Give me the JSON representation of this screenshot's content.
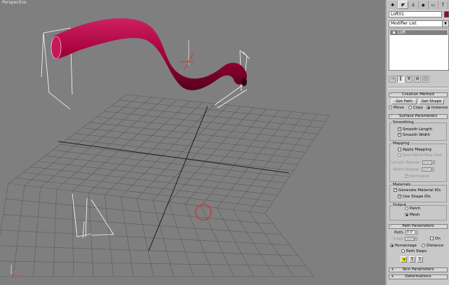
{
  "viewport": {
    "label": "Perspective"
  },
  "command_panel": {
    "tabs": [
      {
        "name": "create",
        "icon": "create-icon",
        "glyph": "✱"
      },
      {
        "name": "modify",
        "icon": "modify-icon",
        "glyph": "◤"
      },
      {
        "name": "hierarchy",
        "icon": "hierarchy-icon",
        "glyph": "♙"
      },
      {
        "name": "motion",
        "icon": "motion-icon",
        "glyph": "◉"
      },
      {
        "name": "display",
        "icon": "display-icon",
        "glyph": "▭"
      },
      {
        "name": "utilities",
        "icon": "utilities-icon",
        "glyph": "T"
      }
    ],
    "object_name": "Loft01",
    "object_color": "#990033",
    "modifier_list": "Modifier List",
    "stack_items": [
      "Loft"
    ],
    "stack_tools": [
      "⊣",
      "‖",
      "∀",
      "⊘",
      "▢"
    ]
  },
  "rollouts": {
    "creation_method": {
      "title": "Creation Method",
      "get_path": "Get Path",
      "get_shape": "Get Shape",
      "move": "Move",
      "copy": "Copy",
      "instance": "Instance",
      "selected": "instance"
    },
    "surface_parameters": {
      "title": "Surface Parameters",
      "smoothing": {
        "title": "Smoothing",
        "smooth_length": "Smooth Length",
        "smooth_width": "Smooth Width"
      },
      "mapping": {
        "title": "Mapping",
        "apply_mapping": "Apply Mapping",
        "real_world": "Real-World Map Size",
        "length_repeat_label": "Length Repeat:",
        "length_repeat": "1.0",
        "width_repeat_label": "Width Repeat:",
        "width_repeat": "1.0",
        "normalize": "Normalize"
      },
      "materials": {
        "title": "Materials",
        "gen_mat_ids": "Generate Material IDs",
        "use_shape_ids": "Use Shape IDs"
      },
      "output": {
        "title": "Output",
        "patch": "Patch",
        "mesh": "Mesh",
        "selected": "mesh"
      }
    },
    "path_parameters": {
      "title": "Path Parameters",
      "path_label": "Path:",
      "path_value": "0.0",
      "snap_label": "Snap:",
      "snap_value": "10.0",
      "on_label": "On",
      "percentage": "Percentage",
      "distance": "Distance",
      "path_steps": "Path Steps",
      "selected": "percentage",
      "tool_glyphs": [
        "⇲",
        "T",
        "T"
      ]
    },
    "skin_parameters": {
      "title": "Skin Parameters"
    },
    "deformations": {
      "title": "Deformations"
    }
  },
  "colors": {
    "viewport_bg": "#7f7f7f",
    "tube": "#b0004a",
    "grid": "#5a5a5a",
    "panel_bg": "#c8c8c8"
  }
}
